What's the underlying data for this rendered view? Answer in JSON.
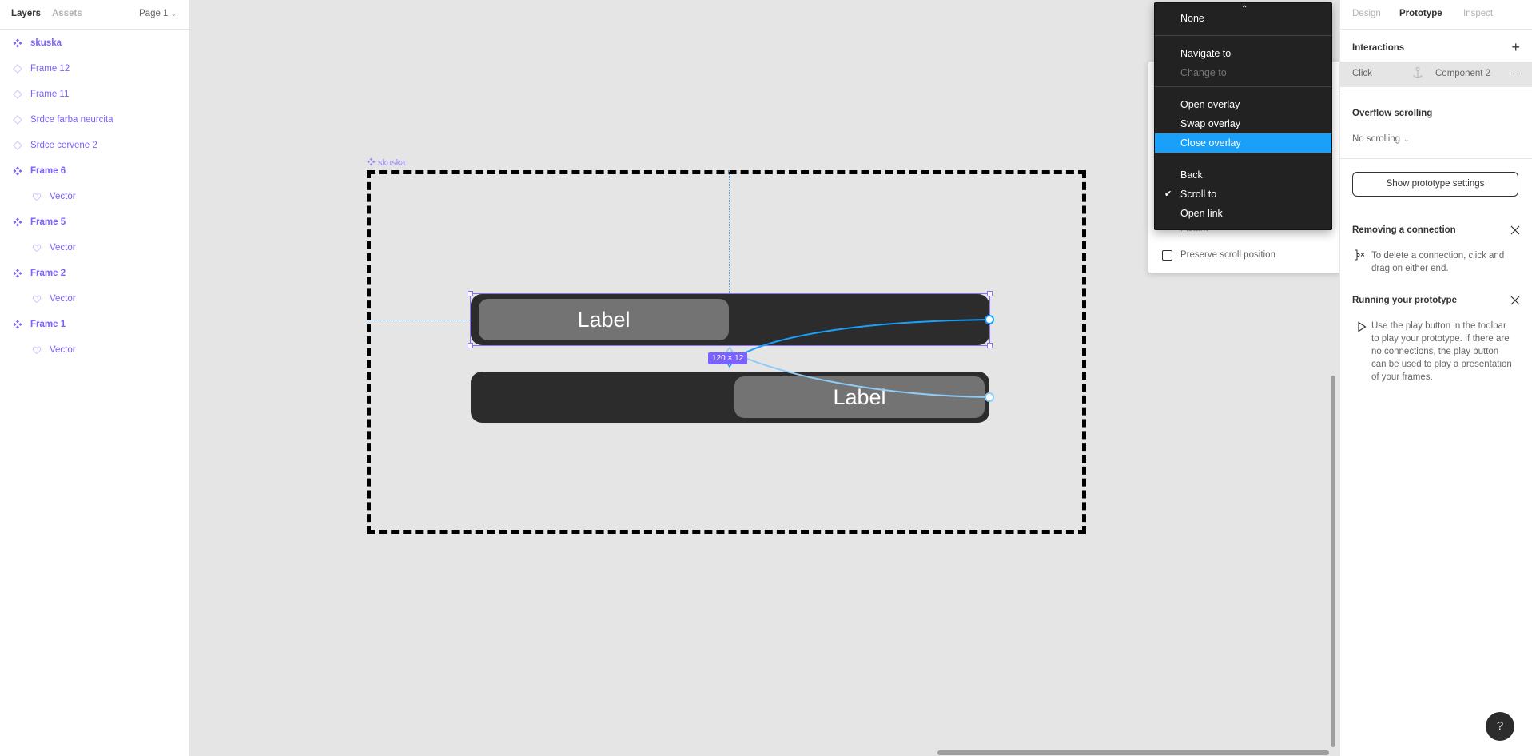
{
  "left_panel": {
    "tabs": [
      "Layers",
      "Assets"
    ],
    "page_selector": "Page 1",
    "layers": [
      {
        "name": "skuska",
        "type": "component",
        "level": 0
      },
      {
        "name": "Frame 12",
        "type": "instance",
        "level": 0
      },
      {
        "name": "Frame 11",
        "type": "instance",
        "level": 0
      },
      {
        "name": "Srdce farba neurcita",
        "type": "instance",
        "level": 0
      },
      {
        "name": "Srdce cervene 2",
        "type": "instance",
        "level": 0
      },
      {
        "name": "Frame 6",
        "type": "component",
        "level": 0
      },
      {
        "name": "Vector",
        "type": "vector",
        "level": 1
      },
      {
        "name": "Frame 5",
        "type": "component",
        "level": 0
      },
      {
        "name": "Vector",
        "type": "vector",
        "level": 1
      },
      {
        "name": "Frame 2",
        "type": "component",
        "level": 0
      },
      {
        "name": "Vector",
        "type": "vector",
        "level": 1
      },
      {
        "name": "Frame 1",
        "type": "component",
        "level": 0
      },
      {
        "name": "Vector",
        "type": "vector",
        "level": 1
      }
    ]
  },
  "canvas": {
    "frame_name": "skuska",
    "variant1_label": "Label",
    "variant2_label": "Label",
    "dimension_badge": "120 × 12"
  },
  "interaction_details": {
    "animation": "Instant",
    "preserve_scroll_label": "Preserve scroll position",
    "preserve_scroll_checked": false
  },
  "action_menu": {
    "groups": [
      [
        {
          "label": "None",
          "state": "normal"
        }
      ],
      [
        {
          "label": "Navigate to",
          "state": "normal"
        },
        {
          "label": "Change to",
          "state": "disabled"
        }
      ],
      [
        {
          "label": "Open overlay",
          "state": "normal"
        },
        {
          "label": "Swap overlay",
          "state": "normal"
        },
        {
          "label": "Close overlay",
          "state": "highlighted"
        }
      ],
      [
        {
          "label": "Back",
          "state": "normal"
        },
        {
          "label": "Scroll to",
          "state": "checked"
        },
        {
          "label": "Open link",
          "state": "normal"
        }
      ]
    ],
    "selected": "Scroll to",
    "hovered": "Close overlay"
  },
  "right_panel": {
    "tabs": [
      "Design",
      "Prototype",
      "Inspect"
    ],
    "active_tab": "Prototype",
    "interactions_title": "Interactions",
    "interaction": {
      "trigger": "Click",
      "destination": "Component 2"
    },
    "overflow_title": "Overflow scrolling",
    "overflow_value": "No scrolling",
    "prototype_settings_button": "Show prototype settings",
    "removing_title": "Removing a connection",
    "removing_text": "To delete a connection, click and drag on either end.",
    "running_title": "Running your prototype",
    "running_text": "Use the play button in the toolbar to play your prototype. If there are no connections, the play button can be used to play a presentation of your frames."
  },
  "help_button": "?",
  "colors": {
    "accent_purple": "#7b61ff",
    "connection_blue": "#18a0fb",
    "menu_bg": "#222222",
    "menu_highlight": "#18a0fb",
    "component_dark": "#2c2c2c",
    "knob_gray": "#737373"
  }
}
